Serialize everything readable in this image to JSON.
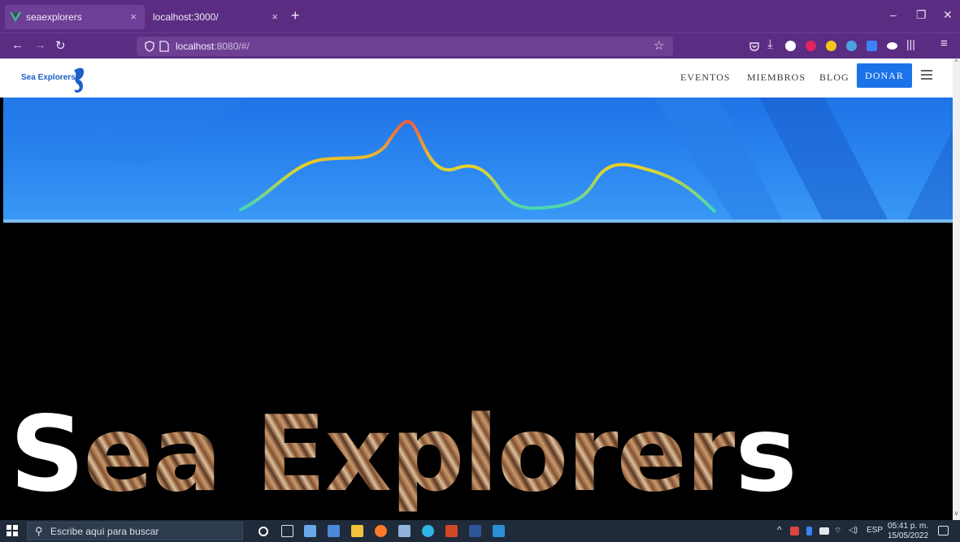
{
  "browser": {
    "tabs": [
      {
        "label": "seaexplorers"
      },
      {
        "label": "localhost:3000/"
      }
    ],
    "url": {
      "host": "localhost",
      "rest": ":8080/#/"
    }
  },
  "site": {
    "logo_text": "Sea Explorers",
    "nav": [
      {
        "label": "EVENTOS"
      },
      {
        "label": "MIEMBROS"
      },
      {
        "label": "BLOG"
      }
    ],
    "donate_label": "DONAR",
    "headline": {
      "first": "S",
      "middle": "ea Explorer",
      "last": "s"
    }
  },
  "taskbar": {
    "search_placeholder": "Escribe aquí para buscar",
    "language": "ESP",
    "time": "05:41 p. m.",
    "date": "15/05/2022"
  },
  "colors": {
    "browser_chrome": "#5a2d82",
    "accent": "#1a73e8",
    "hero_blue": "#2d88f0"
  }
}
